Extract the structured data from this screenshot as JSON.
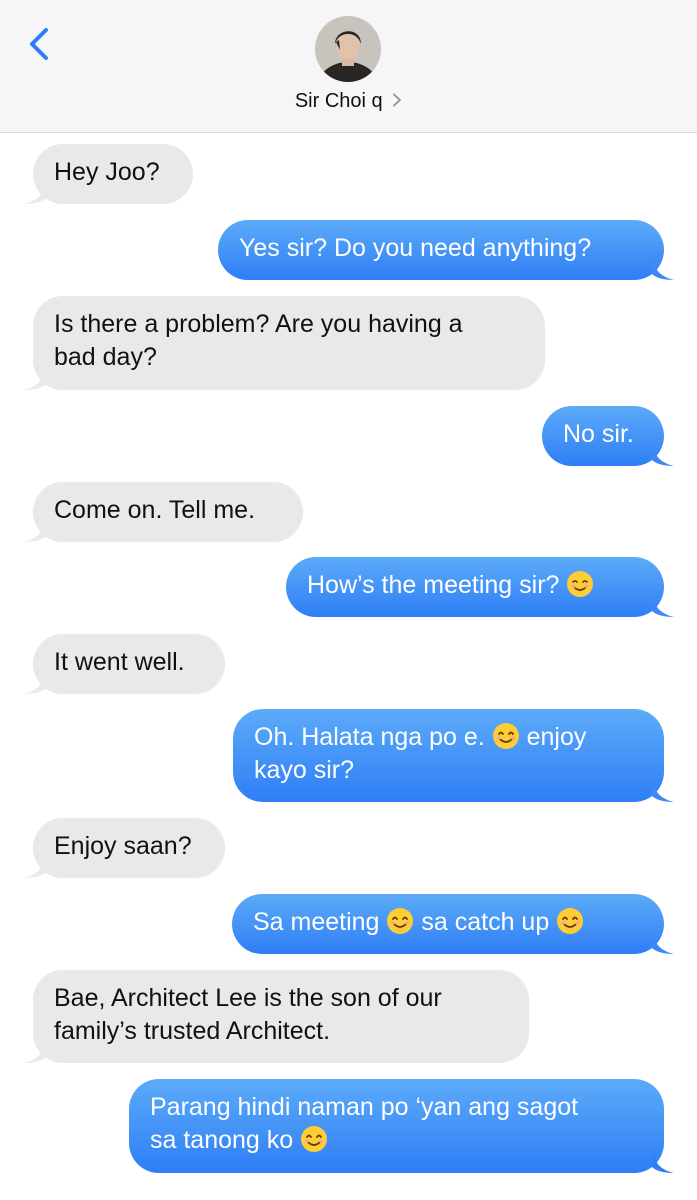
{
  "header": {
    "contact_name": "Sir Choi q",
    "back_icon": "chevron-left-icon",
    "disclosure_icon": "chevron-right-icon"
  },
  "colors": {
    "accent": "#2f7ef5",
    "incoming_bubble": "#e9e9eb",
    "header_bg": "#f6f6f8"
  },
  "messages": [
    {
      "from": "them",
      "text": "Hey Joo?"
    },
    {
      "from": "me",
      "text": "Yes sir? Do you need anything?"
    },
    {
      "from": "them",
      "line1": "Is there a problem? Are you having a",
      "line2": "bad day?"
    },
    {
      "from": "me",
      "text": "No sir."
    },
    {
      "from": "them",
      "text": "Come on. Tell me."
    },
    {
      "from": "me",
      "text": "How’s the meeting sir?",
      "emoji": "relieved-face-icon"
    },
    {
      "from": "them",
      "text": "It went well."
    },
    {
      "from": "me",
      "line1a": "Oh. Halata nga po e.",
      "line1b": "enjoy",
      "line2": "kayo sir?",
      "emoji": "smiling-face-icon"
    },
    {
      "from": "them",
      "text": "Enjoy saan?"
    },
    {
      "from": "me",
      "part1": "Sa meeting",
      "part2": "sa catch up",
      "emoji": "smiling-face-icon"
    },
    {
      "from": "them",
      "line1": "Bae, Architect Lee is the son of our",
      "line2": "family’s trusted Architect."
    },
    {
      "from": "me",
      "line1": "Parang hindi naman po ‘yan ang sagot",
      "line2": "sa tanong ko",
      "emoji": "smiling-face-icon"
    }
  ]
}
